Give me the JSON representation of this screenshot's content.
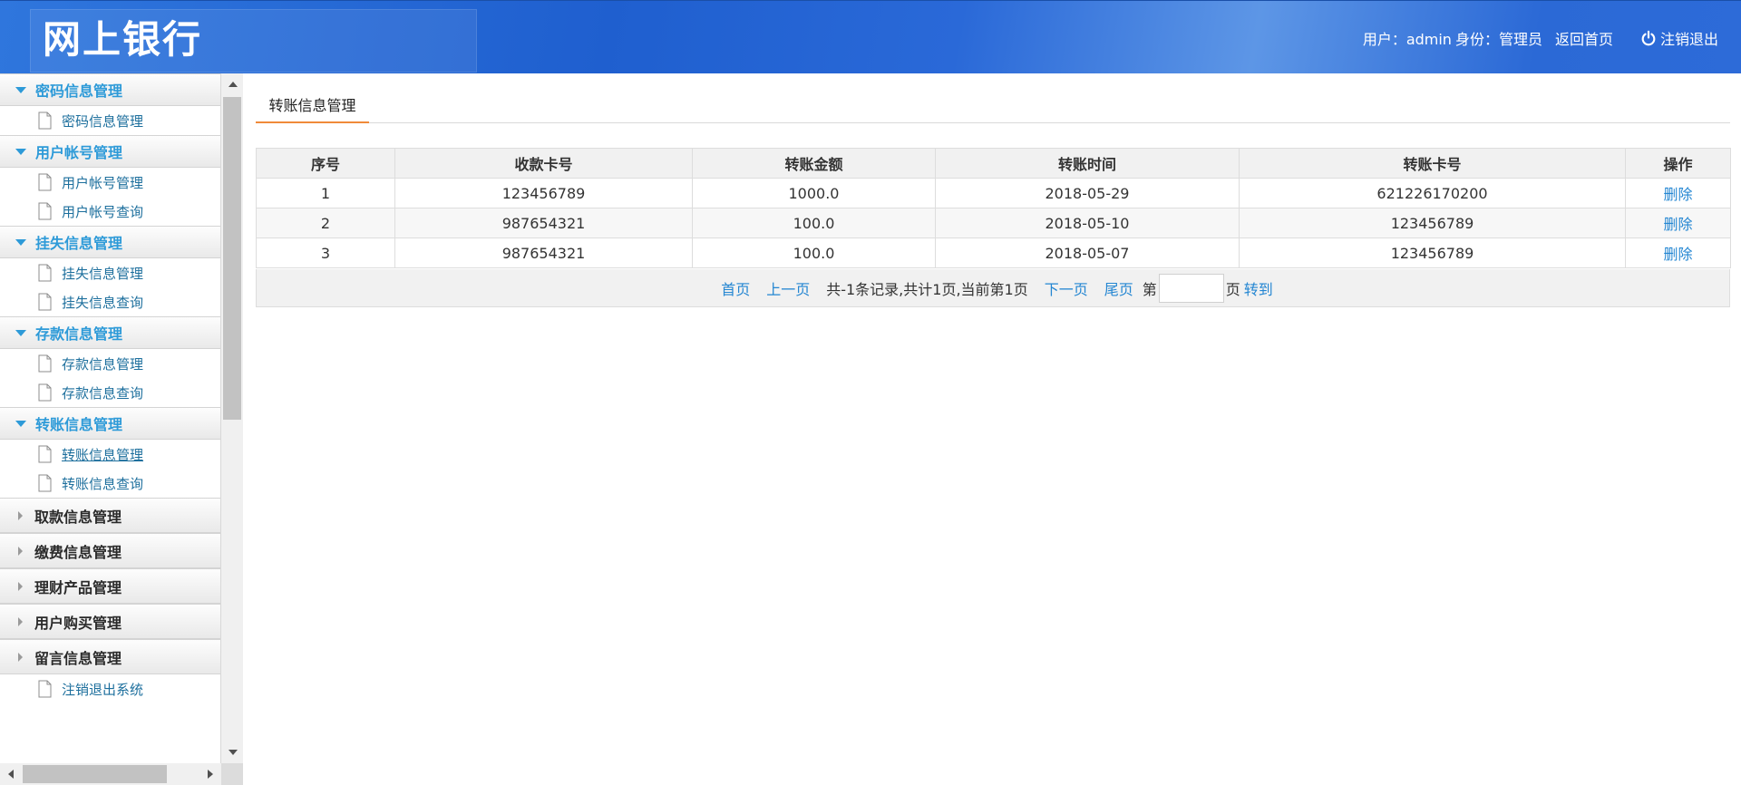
{
  "header": {
    "logo": "网上银行",
    "user_label": "用户：admin",
    "role_label": "身份：管理员",
    "home_link": "返回首页",
    "logout": "注销退出"
  },
  "sidebar": {
    "groups": [
      {
        "title": "密码信息管理",
        "expanded": true,
        "items": [
          "密码信息管理"
        ]
      },
      {
        "title": "用户帐号管理",
        "expanded": true,
        "items": [
          "用户帐号管理",
          "用户帐号查询"
        ]
      },
      {
        "title": "挂失信息管理",
        "expanded": true,
        "items": [
          "挂失信息管理",
          "挂失信息查询"
        ]
      },
      {
        "title": "存款信息管理",
        "expanded": true,
        "items": [
          "存款信息管理",
          "存款信息查询"
        ]
      },
      {
        "title": "转账信息管理",
        "expanded": true,
        "items": [
          "转账信息管理",
          "转账信息查询"
        ]
      },
      {
        "title": "取款信息管理",
        "expanded": false
      },
      {
        "title": "缴费信息管理",
        "expanded": false
      },
      {
        "title": "理财产品管理",
        "expanded": false
      },
      {
        "title": "用户购买管理",
        "expanded": false
      },
      {
        "title": "留言信息管理",
        "expanded": false
      }
    ],
    "footer_item": "注销退出系统"
  },
  "tab": {
    "title": "转账信息管理"
  },
  "table": {
    "columns": [
      "序号",
      "收款卡号",
      "转账金额",
      "转账时间",
      "转账卡号",
      "操作"
    ],
    "rows": [
      [
        "1",
        "123456789",
        "1000.0",
        "2018-05-29",
        "621226170200",
        "删除"
      ],
      [
        "2",
        "987654321",
        "100.0",
        "2018-05-10",
        "123456789",
        "删除"
      ],
      [
        "3",
        "987654321",
        "100.0",
        "2018-05-07",
        "123456789",
        "删除"
      ]
    ]
  },
  "pager": {
    "first": "首页",
    "prev": "上一页",
    "info": "共-1条记录,共计1页,当前第1页",
    "next": "下一页",
    "last": "尾页",
    "page_prefix": "第",
    "page_suffix": "页",
    "go": "转到",
    "page_input_value": ""
  },
  "colors": {
    "header_blue": "#2a69d8",
    "menu_accent": "#2d9ad8",
    "link": "#2486d2",
    "tab_underline": "#f08a3a"
  }
}
